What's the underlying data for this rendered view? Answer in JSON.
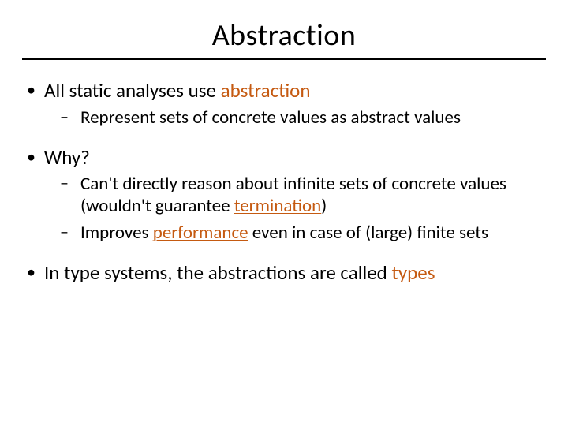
{
  "title": "Abstraction",
  "b1": {
    "pre": "All static analyses use ",
    "kw": "abstraction",
    "sub1": "Represent sets of concrete values as abstract values"
  },
  "b2": {
    "text": "Why?",
    "sub1": {
      "pre": "Can't directly reason about infinite sets of concrete values (wouldn't guarantee ",
      "kw": "termination",
      "post": ")"
    },
    "sub2": {
      "pre": "Improves ",
      "kw": "performance",
      "post": " even in case of (large) finite sets"
    }
  },
  "b3": {
    "pre": "In type systems, the abstractions are called ",
    "kw": "types"
  }
}
